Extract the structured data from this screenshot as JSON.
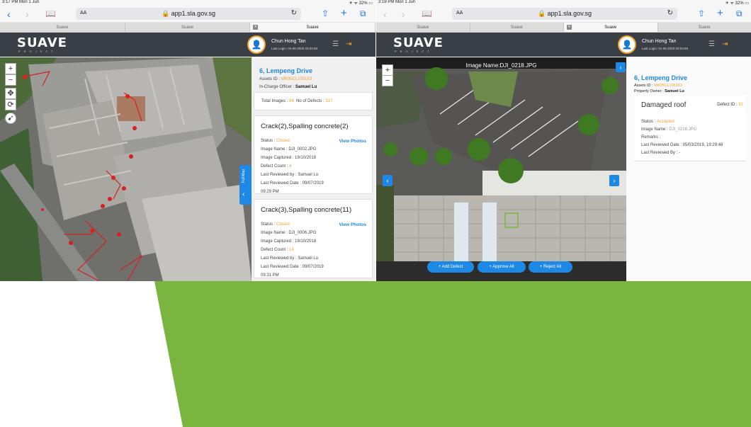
{
  "colors": {
    "accent_green": "#7ab540",
    "brand_blue": "#1e88e5",
    "header_dark": "#3a3e45",
    "status_orange": "#f0a030"
  },
  "left": {
    "status_time": "3:17 PM  Mon 1 Jun",
    "status_right": "32%",
    "url_text_size": "AA",
    "url": "app1.sla.gov.sg",
    "tabs": [
      "Suave",
      "Suave",
      "Suave"
    ],
    "logo": "SUAVE",
    "logo_sub": "PROJECT",
    "user_name": "Chun Hong Tan",
    "last_login": "Last Login: 01-06-2020 03:04:59",
    "full_map_label": "Full Map",
    "address": "6, Lempeng Drive",
    "assets_id_label": "Assets ID : ",
    "assets_id": "MK05CL100163",
    "officer_label": "In-Charge Officer : ",
    "officer": "Samuel Lu",
    "total_images_label": "Total Images : ",
    "total_images": "84",
    "defects_label": "No of Defects : ",
    "defects": "317",
    "view_photos": "View Photos",
    "cards": [
      {
        "title": "Crack(2),Spalling concrete(2)",
        "status_label": "Status : ",
        "status": "Closed",
        "image_name": "Image Name : DJI_0002.JPG",
        "image_captured": "Image Captured : 19/10/2018",
        "defect_count_label": "Defect Count : ",
        "defect_count": "4",
        "last_reviewed_by": "Last Reviewed by : Samuel Lu",
        "last_reviewed_date": "Last Reviewed Date : 09/07/2019",
        "time": "09:29 PM"
      },
      {
        "title": "Crack(3),Spalling concrete(11)",
        "status_label": "Status : ",
        "status": "Closed",
        "image_name": "Image Name : DJI_0006.JPG",
        "image_captured": "Image Captured : 19/10/2018",
        "defect_count_label": "Defect Count : ",
        "defect_count": "14",
        "last_reviewed_by": "Last Reviewed by : Samuel Lu",
        "last_reviewed_date": "Last Reviewed Date : 09/07/2019",
        "time": "09:31 PM"
      }
    ]
  },
  "right": {
    "status_time": "3:19 PM  Mon 1 Jun",
    "status_right": "32%",
    "url_text_size": "AA",
    "url": "app1.sla.gov.sg",
    "tabs": [
      "Suave",
      "Suave",
      "Suave",
      "Suave"
    ],
    "logo": "SUAVE",
    "logo_sub": "PROJECT",
    "user_name": "Chun Hong Tan",
    "last_login": "Last Login: 01-06-2020 03:04:59",
    "image_title": "Image Name:DJI_0218.JPG",
    "btn_add_defect": "+ Add Defect",
    "btn_approve_all": "+ Approve All",
    "btn_reject_all": "+ Reject All",
    "address": "6, Lempeng Drive",
    "assets_id_label": "Assets ID : ",
    "assets_id": "MK05CL100163",
    "owner_label": "Property Owner : ",
    "owner": "Samuel Lu",
    "defect_title": "Damaged roof",
    "defect_id_label": "Defect ID : ",
    "defect_id": "81",
    "status_label": "Status : ",
    "status": "Accepted",
    "image_name_label": "Image Name : ",
    "image_name": "DJI_0218.JPG",
    "remarks": "Remarks :",
    "last_reviewed_date": "Last Reviewed Date : 05/03/2019, 19:29:48",
    "last_reviewed_by": "Last Reviewed By : -"
  }
}
